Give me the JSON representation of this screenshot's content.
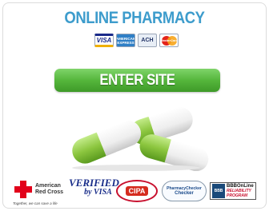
{
  "header": {
    "title": "ONLINE PHARMACY"
  },
  "payment_cards": [
    {
      "name": "visa",
      "label": "VISA"
    },
    {
      "name": "amex",
      "label": "AMERICAN EXPRESS"
    },
    {
      "name": "ach",
      "label": "ACH"
    },
    {
      "name": "mastercard",
      "label": "MasterCard"
    }
  ],
  "cta": {
    "label": "ENTER SITE"
  },
  "trust_badges": {
    "red_cross": {
      "line1": "American",
      "line2": "Red Cross",
      "tagline": "Together, we can save a life"
    },
    "verified_visa": {
      "line1": "VERIFIED",
      "line2": "by VISA"
    },
    "cipa": {
      "label": "CIPA"
    },
    "pharmacy_checker": {
      "line1": "PharmacyChecker",
      "line2": "Checker"
    },
    "bbb": {
      "line1": "BBBOnLine",
      "line2": "RELIABILITY",
      "line3": "PROGRAM"
    }
  },
  "colors": {
    "title": "#3d9ccc",
    "button_top": "#7fd46a",
    "button_bottom": "#3e9a28",
    "pill_green": "#8cc63f",
    "pill_white": "#f4f4f4"
  }
}
